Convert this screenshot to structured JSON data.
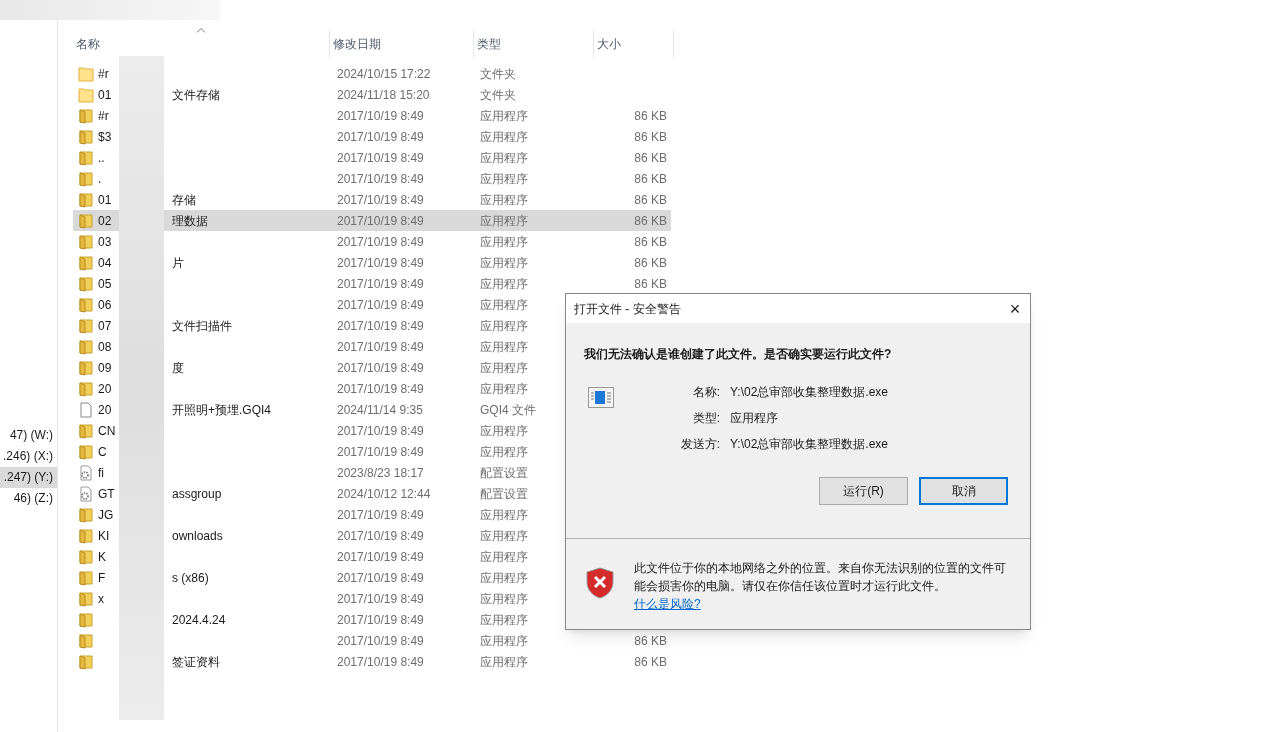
{
  "nav": {
    "items": [
      {
        "label": "47) (W:)",
        "selected": false
      },
      {
        "label": ".246) (X:)",
        "selected": false
      },
      {
        "label": ".247) (Y:)",
        "selected": true
      },
      {
        "label": "46) (Z:)",
        "selected": false
      }
    ]
  },
  "columns": [
    {
      "label": "名称",
      "sorted": true
    },
    {
      "label": "修改日期",
      "sorted": false
    },
    {
      "label": "类型",
      "sorted": false
    },
    {
      "label": "大小",
      "sorted": false
    }
  ],
  "rows": [
    {
      "kind": "folder",
      "prefix": "#r",
      "suffix": "",
      "date": "2024/10/15 17:22",
      "type": "文件夹",
      "size": "",
      "selected": false
    },
    {
      "kind": "folder",
      "prefix": "01",
      "suffix": "文件存储",
      "date": "2024/11/18 15:20",
      "type": "文件夹",
      "size": "",
      "selected": false
    },
    {
      "kind": "app",
      "prefix": "#r",
      "suffix": "",
      "date": "2017/10/19 8:49",
      "type": "应用程序",
      "size": "86 KB",
      "selected": false
    },
    {
      "kind": "app",
      "prefix": "$3",
      "suffix": "",
      "date": "2017/10/19 8:49",
      "type": "应用程序",
      "size": "86 KB",
      "selected": false
    },
    {
      "kind": "app",
      "prefix": "..",
      "suffix": "",
      "date": "2017/10/19 8:49",
      "type": "应用程序",
      "size": "86 KB",
      "selected": false
    },
    {
      "kind": "app",
      "prefix": ".",
      "suffix": "",
      "date": "2017/10/19 8:49",
      "type": "应用程序",
      "size": "86 KB",
      "selected": false
    },
    {
      "kind": "app",
      "prefix": "01",
      "suffix": "存储",
      "date": "2017/10/19 8:49",
      "type": "应用程序",
      "size": "86 KB",
      "selected": false
    },
    {
      "kind": "app",
      "prefix": "02",
      "suffix": "理数据",
      "date": "2017/10/19 8:49",
      "type": "应用程序",
      "size": "86 KB",
      "selected": true
    },
    {
      "kind": "app",
      "prefix": "03",
      "suffix": "",
      "date": "2017/10/19 8:49",
      "type": "应用程序",
      "size": "86 KB",
      "selected": false
    },
    {
      "kind": "app",
      "prefix": "04",
      "suffix": "片",
      "date": "2017/10/19 8:49",
      "type": "应用程序",
      "size": "86 KB",
      "selected": false
    },
    {
      "kind": "app",
      "prefix": "05",
      "suffix": "",
      "date": "2017/10/19 8:49",
      "type": "应用程序",
      "size": "86 KB",
      "selected": false
    },
    {
      "kind": "app",
      "prefix": "06",
      "suffix": "",
      "date": "2017/10/19 8:49",
      "type": "应用程序",
      "size": "",
      "selected": false
    },
    {
      "kind": "app",
      "prefix": "07",
      "suffix": "文件扫描件",
      "date": "2017/10/19 8:49",
      "type": "应用程序",
      "size": "",
      "selected": false
    },
    {
      "kind": "app",
      "prefix": "08",
      "suffix": "",
      "date": "2017/10/19 8:49",
      "type": "应用程序",
      "size": "",
      "selected": false
    },
    {
      "kind": "app",
      "prefix": "09",
      "suffix": "度",
      "date": "2017/10/19 8:49",
      "type": "应用程序",
      "size": "",
      "selected": false
    },
    {
      "kind": "app",
      "prefix": "20",
      "suffix": "",
      "date": "2017/10/19 8:49",
      "type": "应用程序",
      "size": "",
      "selected": false
    },
    {
      "kind": "file",
      "prefix": "20",
      "suffix": "开照明+预埋.GQI4",
      "date": "2024/11/14 9:35",
      "type": "GQI4 文件",
      "size": "",
      "selected": false
    },
    {
      "kind": "app",
      "prefix": "CN",
      "suffix": "",
      "date": "2017/10/19 8:49",
      "type": "应用程序",
      "size": "",
      "selected": false
    },
    {
      "kind": "app",
      "prefix": "C",
      "suffix": "",
      "date": "2017/10/19 8:49",
      "type": "应用程序",
      "size": "",
      "selected": false
    },
    {
      "kind": "config",
      "prefix": "fi",
      "suffix": "",
      "date": "2023/8/23 18:17",
      "type": "配置设置",
      "size": "",
      "selected": false
    },
    {
      "kind": "config",
      "prefix": "GT",
      "suffix": "assgroup",
      "date": "2024/10/12 12:44",
      "type": "配置设置",
      "size": "",
      "selected": false
    },
    {
      "kind": "app",
      "prefix": "JG",
      "suffix": "",
      "date": "2017/10/19 8:49",
      "type": "应用程序",
      "size": "",
      "selected": false
    },
    {
      "kind": "app",
      "prefix": "KI",
      "suffix": "ownloads",
      "date": "2017/10/19 8:49",
      "type": "应用程序",
      "size": "",
      "selected": false
    },
    {
      "kind": "app",
      "prefix": "K",
      "suffix": "",
      "date": "2017/10/19 8:49",
      "type": "应用程序",
      "size": "",
      "selected": false
    },
    {
      "kind": "app",
      "prefix": "F",
      "suffix": "s (x86)",
      "date": "2017/10/19 8:49",
      "type": "应用程序",
      "size": "",
      "selected": false
    },
    {
      "kind": "app",
      "prefix": "x",
      "suffix": "",
      "date": "2017/10/19 8:49",
      "type": "应用程序",
      "size": "",
      "selected": false
    },
    {
      "kind": "app",
      "prefix": "",
      "suffix": "2024.4.24",
      "date": "2017/10/19 8:49",
      "type": "应用程序",
      "size": "",
      "selected": false
    },
    {
      "kind": "app",
      "prefix": "",
      "suffix": "",
      "date": "2017/10/19 8:49",
      "type": "应用程序",
      "size": "86 KB",
      "selected": false
    },
    {
      "kind": "app",
      "prefix": "",
      "suffix": "签证资料",
      "date": "2017/10/19 8:49",
      "type": "应用程序",
      "size": "86 KB",
      "selected": false
    }
  ],
  "dialog": {
    "title": "打开文件 - 安全警告",
    "close": "×",
    "question": "我们无法确认是谁创建了此文件。是否确实要运行此文件?",
    "fields": [
      {
        "label": "名称:",
        "value": "Y:\\02总审部收集整理数据.exe"
      },
      {
        "label": "类型:",
        "value": "应用程序"
      },
      {
        "label": "发送方:",
        "value": "Y:\\02总审部收集整理数据.exe"
      }
    ],
    "buttons": [
      {
        "label": "运行(R)",
        "focused": false
      },
      {
        "label": "取消",
        "focused": true
      }
    ],
    "warning": "此文件位于你的本地网络之外的位置。来自你无法识别的位置的文件可能会损害你的电脑。请仅在你信任该位置时才运行此文件。",
    "link": "什么是风险?"
  }
}
